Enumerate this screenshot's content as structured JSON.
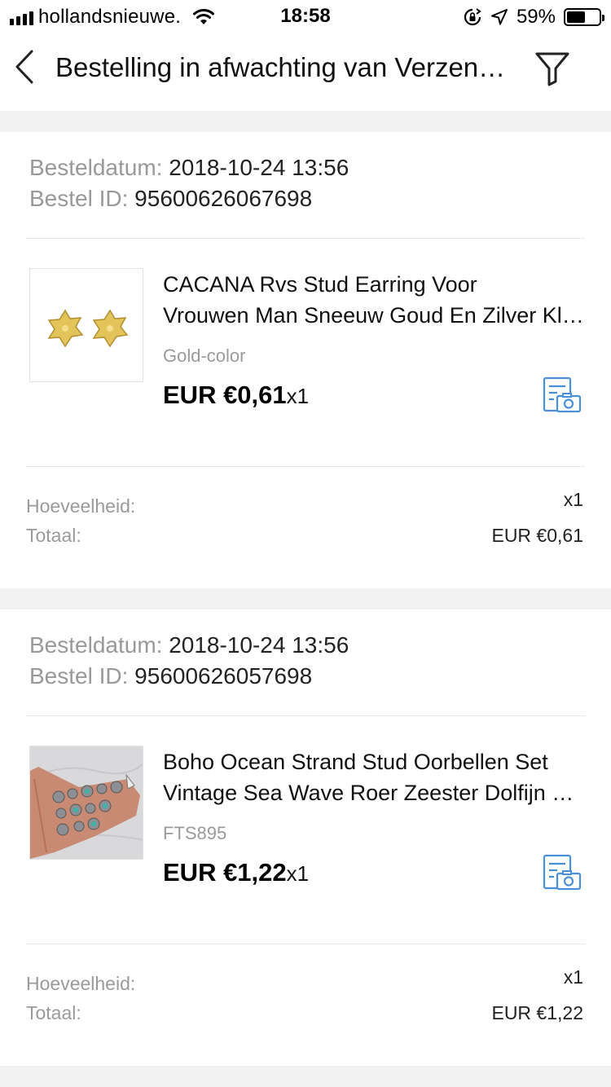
{
  "status_bar": {
    "carrier": "hollandsnieuwe.",
    "time": "18:58",
    "battery_percent": "59%",
    "battery_level": 0.59,
    "icons": [
      "signal-icon",
      "wifi-icon",
      "rotation-lock-icon",
      "location-arrow-icon",
      "battery-icon"
    ]
  },
  "nav": {
    "title": "Bestelling in afwachting van Verzending",
    "back_icon": "chevron-left-icon",
    "filter_icon": "filter-icon"
  },
  "orders": [
    {
      "date_label": "Besteldatum:",
      "date_value": "2018-10-24 13:56",
      "id_label": "Bestel ID:",
      "id_value": "95600626067698",
      "product": {
        "name_line1": "CACANA Rvs Stud Earring Voor",
        "name_line2": "Vrouwen Man Sneeuw Goud En Zilver Kleur",
        "variant": "Gold-color",
        "price": "EUR €0,61",
        "qty": "x1",
        "thumb": "gold-snowflake-earrings",
        "review_icon": "photo-review-icon"
      },
      "summary": {
        "qty_label": "Hoeveelheid:",
        "qty_value": "x1",
        "total_label": "Totaal:",
        "total_value": "EUR €0,61"
      }
    },
    {
      "date_label": "Besteldatum:",
      "date_value": "2018-10-24 13:56",
      "id_label": "Bestel ID:",
      "id_value": "95600626057698",
      "product": {
        "name_line1": "Boho Ocean Strand Stud Oorbellen Set",
        "name_line2": "Vintage Sea Wave Roer Zeester Dolfijn Oorbellen",
        "variant": "FTS895",
        "price": "EUR €1,22",
        "qty": "x1",
        "thumb": "hand-holding-earring-set",
        "review_icon": "photo-review-icon"
      },
      "summary": {
        "qty_label": "Hoeveelheid:",
        "qty_value": "x1",
        "total_label": "Totaal:",
        "total_value": "EUR €1,22"
      }
    }
  ],
  "colors": {
    "accent_blue": "#4a90d9",
    "label_gray": "#999999",
    "separator": "#f2f2f2"
  }
}
